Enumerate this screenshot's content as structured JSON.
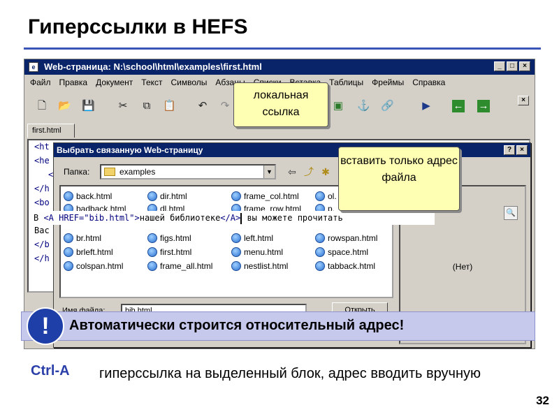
{
  "slide": {
    "title": "Гиперссылки в HEFS",
    "number": "32"
  },
  "window": {
    "title": "Web-страница: N:\\school\\html\\examples\\first.html",
    "controls": [
      "_",
      "□",
      "×"
    ],
    "menu": [
      "Файл",
      "Правка",
      "Документ",
      "Текст",
      "Символы",
      "Абзацы",
      "Списки",
      "Вставка",
      "Таблицы",
      "Фреймы",
      "Справка"
    ],
    "toolbar_close": "×",
    "doc_tab": "first.html",
    "code_lines": [
      "<ht",
      "<he",
      "<",
      "</h",
      "<bo",
      "B",
      "Bac",
      "</b",
      "</h"
    ]
  },
  "dialog": {
    "title": "Выбрать связанную Web-страницу",
    "controls": [
      "?",
      "×"
    ],
    "folder_label": "Папка:",
    "folder_value": "examples",
    "files": [
      [
        "back.html",
        "dir.html",
        "frame_col.html",
        "ol."
      ],
      [
        "badback.html",
        "dl.html",
        "frame_row.html",
        "p."
      ],
      [
        "br.html",
        "figs.html",
        "left.html",
        "rowspan.html"
      ],
      [
        "brleft.html",
        "first.html",
        "menu.html",
        "space.html"
      ],
      [
        "colspan.html",
        "frame_all.html",
        "nestlist.html",
        "tabback.html"
      ]
    ],
    "preview_text": "(Нет)",
    "filename_label": "Имя файла:",
    "filename_value": "bib.html",
    "open_button": "Открыть"
  },
  "code_strip": {
    "prefix": "В ",
    "open_tag": "<A HREF=\"bib.html\">",
    "link_text": "нашей библиотеке",
    "close_tag": "</A>",
    "suffix": " вы можете прочитать"
  },
  "callouts": {
    "local": "локальная ссылка",
    "insert": "вставить только адрес файла"
  },
  "banner": {
    "icon": "!",
    "text": "Автоматически строится относительный адрес!"
  },
  "footnote": {
    "key": "Ctrl-A",
    "text": "гиперссылка на выделенный блок, адрес вводить вручную"
  }
}
